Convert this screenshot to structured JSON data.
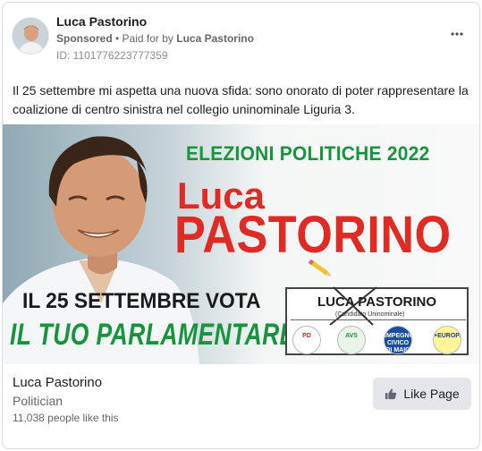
{
  "header": {
    "page_name": "Luca Pastorino",
    "sponsored_label": "Sponsored",
    "separator": " • ",
    "paid_for_prefix": "Paid for by ",
    "paid_for_name": "Luca Pastorino",
    "ad_id": "ID: 1101776223777359",
    "more_icon": "ellipsis-icon"
  },
  "post": {
    "text": "Il 25 settembre mi aspetta una nuova sfida: sono onorato di poter rappresentare la coalizione di centro sinistra nel collegio uninominale Liguria 3."
  },
  "creative": {
    "title": "ELEZIONI POLITICHE 2022",
    "first_name": "Luca",
    "last_name": "PASTORINO",
    "date_line": "IL 25 SETTEMBRE VOTA",
    "slogan": "IL TUO PARLAMENTARE",
    "ballot_name": "LUCA PASTORINO",
    "ballot_sub": "(Candidato Uninominale)",
    "parties": [
      "PD",
      "AVS",
      "IMPEGNO CIVICO DI MAIO",
      "+EUROPA"
    ],
    "colors": {
      "green": "#17953c",
      "red": "#e02a24"
    }
  },
  "footer": {
    "name": "Luca Pastorino",
    "category": "Politician",
    "likes": "11,038 people like this",
    "like_button": "Like Page",
    "like_icon": "thumbs-up-icon"
  }
}
